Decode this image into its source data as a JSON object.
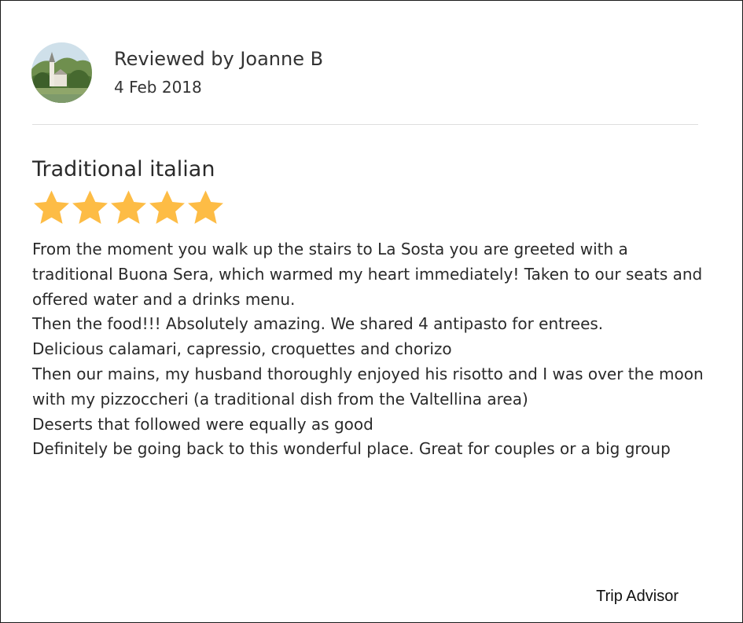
{
  "reviewer": {
    "avatar_icon": "church-landscape-avatar",
    "name": "Reviewed by Joanne B",
    "date": "4 Feb 2018"
  },
  "review": {
    "title": "Traditional italian",
    "rating": 5,
    "rating_max": 5,
    "star_icon": "star-icon",
    "star_color": "#FDBC45",
    "body_lines": [
      "From the moment you walk up the stairs to La Sosta you are greeted with a traditional Buona Sera, which warmed my heart immediately! Taken to our seats and offered water and a drinks menu.",
      "Then the food!!! Absolutely amazing. We shared 4 antipasto for entrees.",
      "Delicious calamari, capressio, croquettes and chorizo",
      "Then our mains, my husband thoroughly enjoyed his risotto and I was over the moon with my pizzoccheri (a traditional dish from the Valtellina area)",
      "Deserts that followed were equally as good",
      "Definitely be going back to this wonderful place. Great for couples or a big group"
    ]
  },
  "footer": {
    "source": "Trip Advisor"
  }
}
